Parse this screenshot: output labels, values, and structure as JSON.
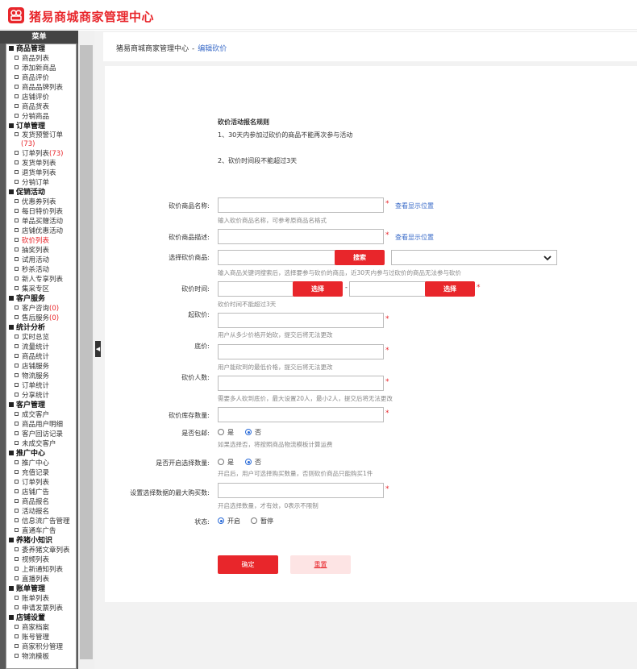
{
  "app": {
    "title": "猪易商城商家管理中心"
  },
  "sidebar": {
    "header": "菜单",
    "groups": [
      {
        "title": "商品管理",
        "items": [
          {
            "label": "商品列表"
          },
          {
            "label": "添加新商品"
          },
          {
            "label": "商品评价"
          },
          {
            "label": "商品品牌列表"
          },
          {
            "label": "店铺评价"
          },
          {
            "label": "商品货表"
          },
          {
            "label": "分销商品"
          }
        ]
      },
      {
        "title": "订单管理",
        "items": [
          {
            "label": "发货预警订单",
            "badge": "(73)"
          },
          {
            "label": "订单列表",
            "badge": "(73)"
          },
          {
            "label": "发货单列表"
          },
          {
            "label": "退货单列表"
          },
          {
            "label": "分销订单"
          }
        ]
      },
      {
        "title": "促销活动",
        "items": [
          {
            "label": "优惠券列表"
          },
          {
            "label": "每日特价列表"
          },
          {
            "label": "单品买赠活动"
          },
          {
            "label": "店铺优惠活动"
          },
          {
            "label": "砍价列表",
            "active": true
          },
          {
            "label": "抽奖列表"
          },
          {
            "label": "试用活动"
          },
          {
            "label": "秒杀活动"
          },
          {
            "label": "新人专享列表"
          },
          {
            "label": "集采专区"
          }
        ]
      },
      {
        "title": "客户服务",
        "items": [
          {
            "label": "客户咨询",
            "badge": "(0)"
          },
          {
            "label": "售后服务",
            "badge": "(0)"
          }
        ]
      },
      {
        "title": "统计分析",
        "items": [
          {
            "label": "实时总览"
          },
          {
            "label": "流量统计"
          },
          {
            "label": "商品统计"
          },
          {
            "label": "店铺服务"
          },
          {
            "label": "物流服务"
          },
          {
            "label": "订单统计"
          },
          {
            "label": "分享统计"
          }
        ]
      },
      {
        "title": "客户管理",
        "items": [
          {
            "label": "成交客户"
          },
          {
            "label": "商品用户明细"
          },
          {
            "label": "客户回访记录"
          },
          {
            "label": "未成交客户"
          }
        ]
      },
      {
        "title": "推广中心",
        "items": [
          {
            "label": "推广中心"
          },
          {
            "label": "充值记录"
          },
          {
            "label": "订单列表"
          },
          {
            "label": "店铺广告"
          },
          {
            "label": "商品报名"
          },
          {
            "label": "活动报名"
          },
          {
            "label": "信息流广告管理"
          },
          {
            "label": "直通车广告"
          }
        ]
      },
      {
        "title": "养猪小知识",
        "items": [
          {
            "label": "委养猪文章列表"
          },
          {
            "label": "视频列表"
          },
          {
            "label": "上新通知列表"
          },
          {
            "label": "直播列表"
          }
        ]
      },
      {
        "title": "账单管理",
        "items": [
          {
            "label": "账单列表"
          },
          {
            "label": "申请发票列表"
          }
        ]
      },
      {
        "title": "店铺设置",
        "items": [
          {
            "label": "商家档案"
          },
          {
            "label": "账号管理"
          },
          {
            "label": "商家积分管理"
          },
          {
            "label": "物流模板"
          }
        ]
      }
    ]
  },
  "breadcrumb": {
    "root": "猪易商城商家管理中心",
    "sep": "-",
    "current": "编辑砍价"
  },
  "rules": {
    "title": "砍价活动报名规则",
    "line1": "1、30天内参加过砍价的商品不能再次参与活动",
    "line2": "2、砍价时间段不能超过3天"
  },
  "form": {
    "name_label": "砍价商品名称:",
    "name_hint": "输入砍价商品名称，可参考原商品名格式",
    "name_link": "查看显示位置",
    "desc_label": "砍价商品描述:",
    "desc_link": "查看显示位置",
    "select_label": "选择砍价商品:",
    "search_btn": "搜索",
    "select_hint": "输入商品关键词搜索后，选择要参与砍价的商品，近30天内参与过砍价的商品无法参与砍价",
    "time_label": "砍价时间:",
    "time_btn": "选择",
    "time_sep": "-",
    "time_hint": "砍价时间不能超过3天",
    "start_label": "起砍价:",
    "start_hint": "用户从多少价格开始砍，提交后将无法更改",
    "floor_label": "底价:",
    "floor_hint": "用户能砍到的最低价格，提交后将无法更改",
    "people_label": "砍价人数:",
    "people_hint": "需要多人砍到底价，最大设置20人，最小2人，提交后将无法更改",
    "stock_label": "砍价库存数量:",
    "shipping_label": "是否包邮:",
    "shipping_yes": "是",
    "shipping_no": "否",
    "shipping_hint": "如果选择否，将按照商品物流模板计算运费",
    "qty_label": "是否开启选择数量:",
    "qty_yes": "是",
    "qty_no": "否",
    "qty_hint": "开启后，用户可选择购买数量，否则砍价商品只能购买1件",
    "max_label": "设置选择数据的最大购买数:",
    "max_hint": "开启选择数量，才有效，0表示不限制",
    "status_label": "状态:",
    "status_on": "开启",
    "status_off": "暂停",
    "submit": "确定",
    "reset": "重置",
    "required_mark": "*"
  },
  "colors": {
    "brand": "#e8262b",
    "link": "#3a6bc8"
  }
}
